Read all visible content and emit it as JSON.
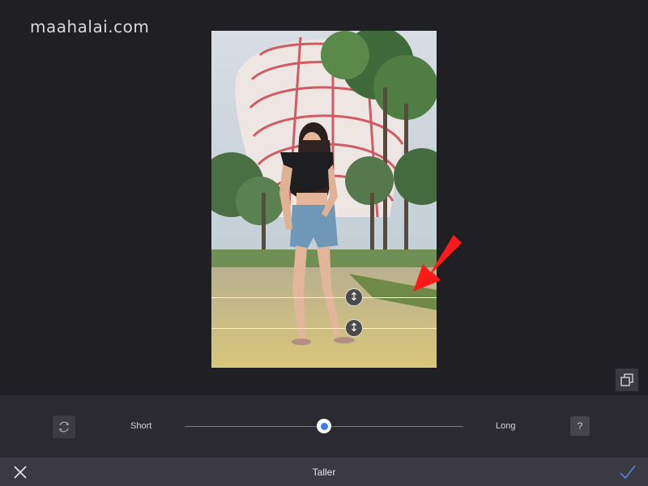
{
  "watermark": "maahalai.com",
  "editor": {
    "tool_title": "Taller",
    "slider": {
      "min_label": "Short",
      "max_label": "Long",
      "value_fraction": 0.5
    },
    "help_label": "?",
    "guides_count": 2
  },
  "icons": {
    "reset": "reset-rotate-icon",
    "compare": "compare-icon",
    "close": "close-icon",
    "confirm": "checkmark-icon",
    "guide_handle": "vertical-resize-icon",
    "annotation": "red-arrow-icon"
  },
  "colors": {
    "background": "#1f1e23",
    "toolbar": "#2b2a30",
    "bottom_bar": "#3b3a42",
    "accent": "#3f7ce8",
    "annotation": "#ff1a1a"
  }
}
